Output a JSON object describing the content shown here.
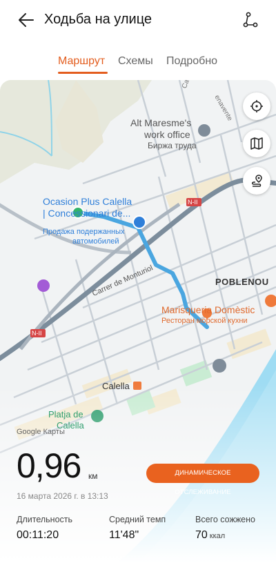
{
  "header": {
    "title": "Ходьба на улице",
    "back_icon": "arrow-left-icon",
    "share_icon": "share-route-icon"
  },
  "tabs": [
    {
      "label": "Маршрут",
      "active": true
    },
    {
      "label": "Схемы",
      "active": false
    },
    {
      "label": "Подробно",
      "active": false
    }
  ],
  "map": {
    "labels": {
      "alt_maresme_1": "Alt Maresme's",
      "alt_maresme_2": "work office",
      "alt_maresme_3": "Биржа труда",
      "ocasion_1": "Ocasion Plus Calella",
      "ocasion_2": "| Concessionari de...",
      "ocasion_3": "Продажа подержанных",
      "ocasion_4": "автомобилей",
      "poblenou": "POBLENOU",
      "marisqueria_1": "Marisqueria Domèstic",
      "marisqueria_2": "Ресторан морской кухни",
      "carrer_monturiol": "Carrer de Monturiol",
      "calella": "Calella",
      "platja_1": "Platja de",
      "platja_2": "Calella",
      "n2_a": "N-II",
      "n2_b": "N-II",
      "carrer_e": "Carrer E",
      "benavente": "enavente"
    },
    "buttons": [
      "recenter-icon",
      "map-layers-icon",
      "route-pin-icon"
    ],
    "credit": "Google Карты",
    "route_color": "#4aa6e0"
  },
  "summary": {
    "distance": "0,96",
    "distance_unit": "км",
    "tracking_button": "ДИНАМИЧЕСКОЕ ОТСЛЕЖИВАНИЕ",
    "date": "16 марта 2026 г. в 13:13",
    "stats": [
      {
        "label": "Длительность",
        "value": "00:11:20",
        "unit": ""
      },
      {
        "label": "Средний темп",
        "value": "11'48\"",
        "unit": ""
      },
      {
        "label": "Всего сожжено",
        "value": "70",
        "unit": "ккал"
      }
    ]
  },
  "colors": {
    "accent": "#e35d1e",
    "route": "#4aa6e0"
  }
}
